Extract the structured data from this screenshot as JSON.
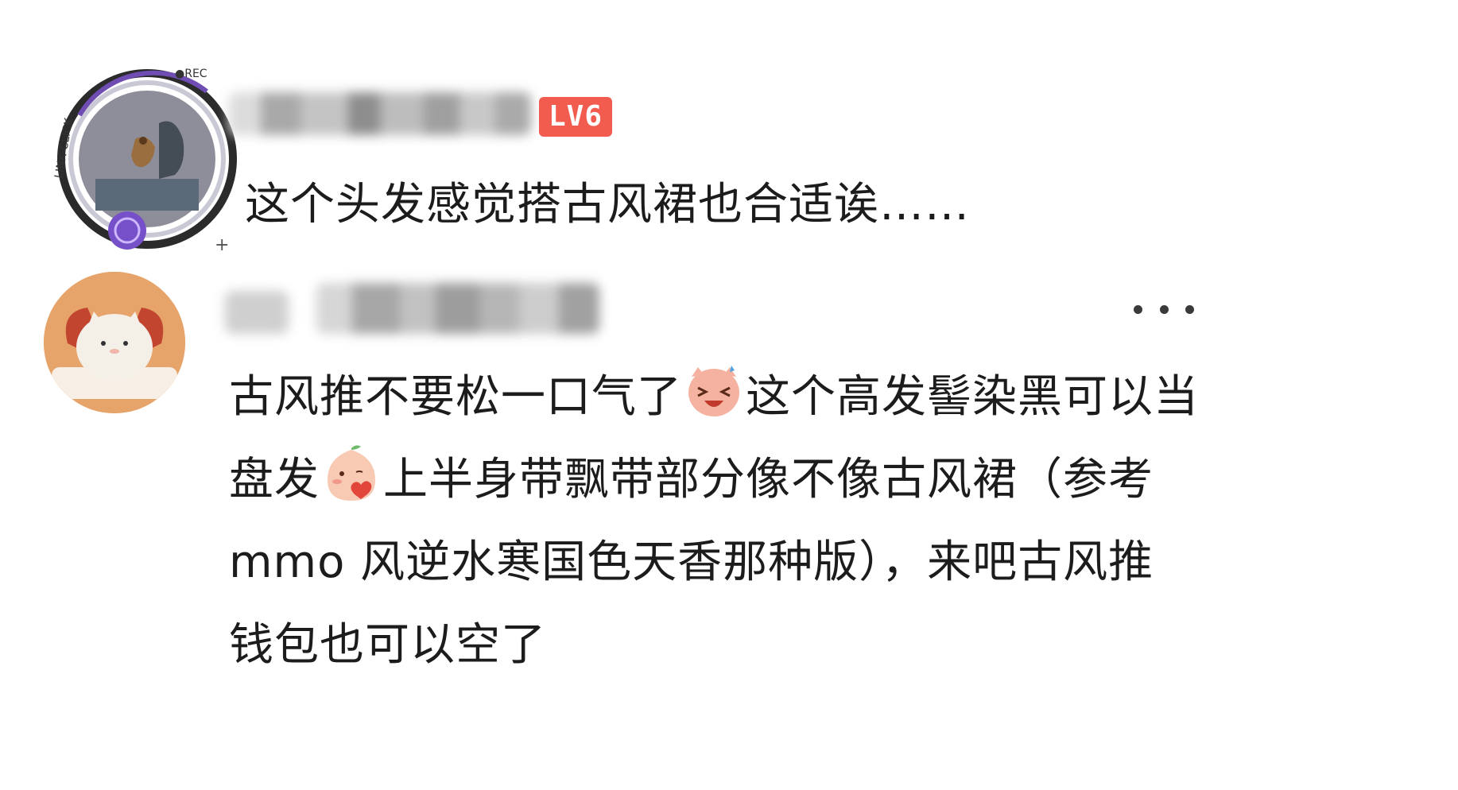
{
  "comments": [
    {
      "level": "LV6",
      "text": "这个头发感觉搭古风裙也合适诶……",
      "avatar_frame_text": "LINK·CLICK",
      "avatar_frame_rec": "●REC"
    },
    {
      "text_part1": "古风推不要松一口气了",
      "text_part2": "这个高发髻染黑可以当盘发",
      "text_part3": "上半身带飘带部分像不像古风裙（参考 mmo 风逆水寒国色天香那种版），来吧古风推钱包也可以空了",
      "emoji_1": "laughing-face-emoji",
      "emoji_2": "kiss-heart-emoji"
    }
  ],
  "colors": {
    "level_badge": "#f25c4e",
    "text": "#1c1c1c"
  }
}
